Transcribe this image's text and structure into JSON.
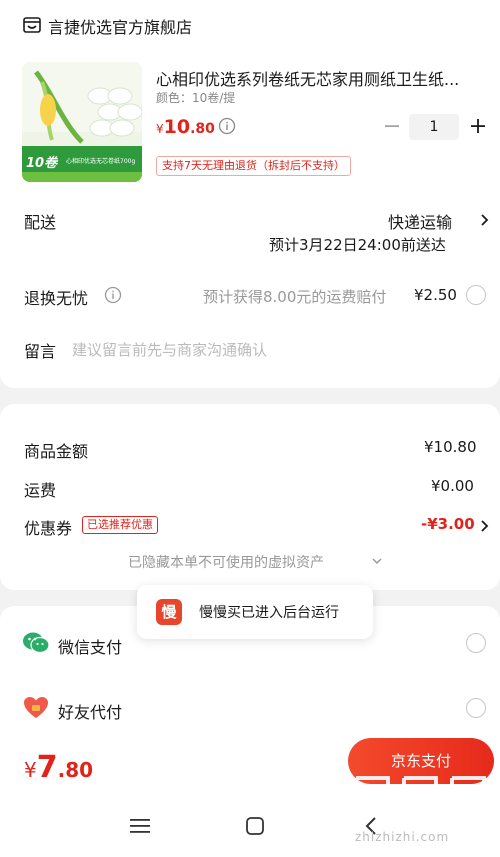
{
  "store": {
    "name": "言捷优选官方旗舰店",
    "icon": "store-icon"
  },
  "product": {
    "title": "心相印优选系列卷纸无芯家用厕纸卫生纸...",
    "spec": "颜色：10卷/提",
    "price_currency": "¥",
    "price_int": "10",
    "price_dec": ".80",
    "quantity": "1",
    "return_tag": "支持7天无理由退货（拆封后不支持）",
    "thumb_badge": "10卷",
    "thumb_caption": "心相印优选无芯卷纸700g"
  },
  "delivery": {
    "label": "配送",
    "method": "快递运输",
    "eta": "预计3月22日24:00前送达"
  },
  "return_insurance": {
    "label": "退换无忧",
    "desc": "预计获得8.00元的运费赔付",
    "price": "¥2.50"
  },
  "note": {
    "label": "留言",
    "placeholder": "建议留言前先与商家沟通确认"
  },
  "summary": {
    "goods_label": "商品金额",
    "goods_value": "¥10.80",
    "shipping_label": "运费",
    "shipping_value": "¥0.00",
    "coupon_label": "优惠券",
    "coupon_tag": "已选推荐优惠",
    "coupon_value": "-¥3.00",
    "hidden_assets": "已隐藏本单不可使用的虚拟资产"
  },
  "toast": {
    "logo_char": "慢",
    "text": "慢慢买已进入后台运行"
  },
  "payment": {
    "wechat_label": "微信支付",
    "friend_label": "好友代付"
  },
  "footer": {
    "total_currency": "¥",
    "total_int": "7",
    "total_dec": ".80",
    "pay_button": "京东支付"
  },
  "watermark": {
    "text": "zhizhizhi.com"
  },
  "colors": {
    "accent": "#e2231a",
    "wechat": "#2aae67",
    "friend": "#f0584a"
  }
}
